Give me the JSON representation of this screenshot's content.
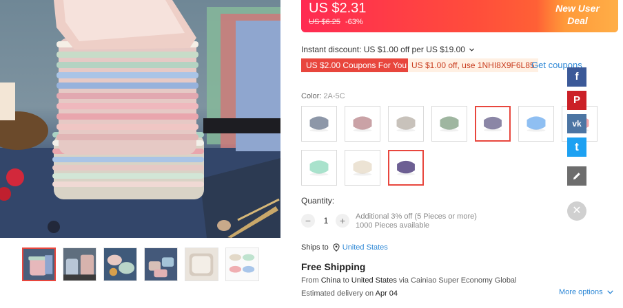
{
  "price": {
    "current": "US $2.31",
    "original": "US $6.25",
    "discount": "-63%",
    "promo_line1": "New User",
    "promo_line2": "Deal"
  },
  "discount": {
    "instant": "Instant discount: US $1.00 off per US $19.00",
    "coupon_red": "US $2.00 Coupons For You",
    "coupon_code": "US $1.00 off, use 1NHI8X9F6L85",
    "get_coupons": "Get coupons"
  },
  "color": {
    "label": "Color:",
    "selected_value": "2A-5C",
    "swatches": [
      {
        "color": "#8d97a8",
        "selected": false
      },
      {
        "color": "#c9a2a6",
        "selected": false
      },
      {
        "color": "#c8c2bb",
        "selected": false
      },
      {
        "color": "#9fb6a0",
        "selected": false
      },
      {
        "color": "#8b86a6",
        "selected": true
      },
      {
        "color": "#8fbff2",
        "selected": false
      },
      {
        "color": "#f0a4a8",
        "selected": false
      },
      {
        "color": "#a9e2cc",
        "selected": false
      },
      {
        "color": "#ece3d4",
        "selected": false
      },
      {
        "color": "#6d5f93",
        "selected": true
      }
    ]
  },
  "quantity": {
    "label": "Quantity:",
    "minus": "−",
    "plus": "+",
    "value": "1",
    "note1": "Additional 3% off (5 Pieces or more)",
    "note2": "1000 Pieces available"
  },
  "shipping": {
    "ships_to_label": "Ships to",
    "ships_to_country": "United States",
    "free_shipping": "Free Shipping",
    "from_word": "From",
    "from_country": "China",
    "to_word": "to",
    "to_country": "United States",
    "via": "via Cainiao Super Economy Global",
    "estimated_label": "Estimated delivery on",
    "estimated_date": "Apr 04",
    "more_options": "More options"
  },
  "share": {
    "facebook": "f",
    "pinterest": "P",
    "vk": "vk",
    "twitter": "t",
    "close": "✕"
  },
  "colors": {
    "accent_red": "#e8463d",
    "link_blue": "#2e88d6",
    "facebook": "#3b5998",
    "pinterest": "#cb2027",
    "vk": "#4c75a3",
    "twitter": "#1da1f2",
    "edit": "#6d6d6d"
  },
  "icons": [
    "chevron-down-icon",
    "location-pin-icon",
    "edit-pencil-icon",
    "close-icon"
  ]
}
